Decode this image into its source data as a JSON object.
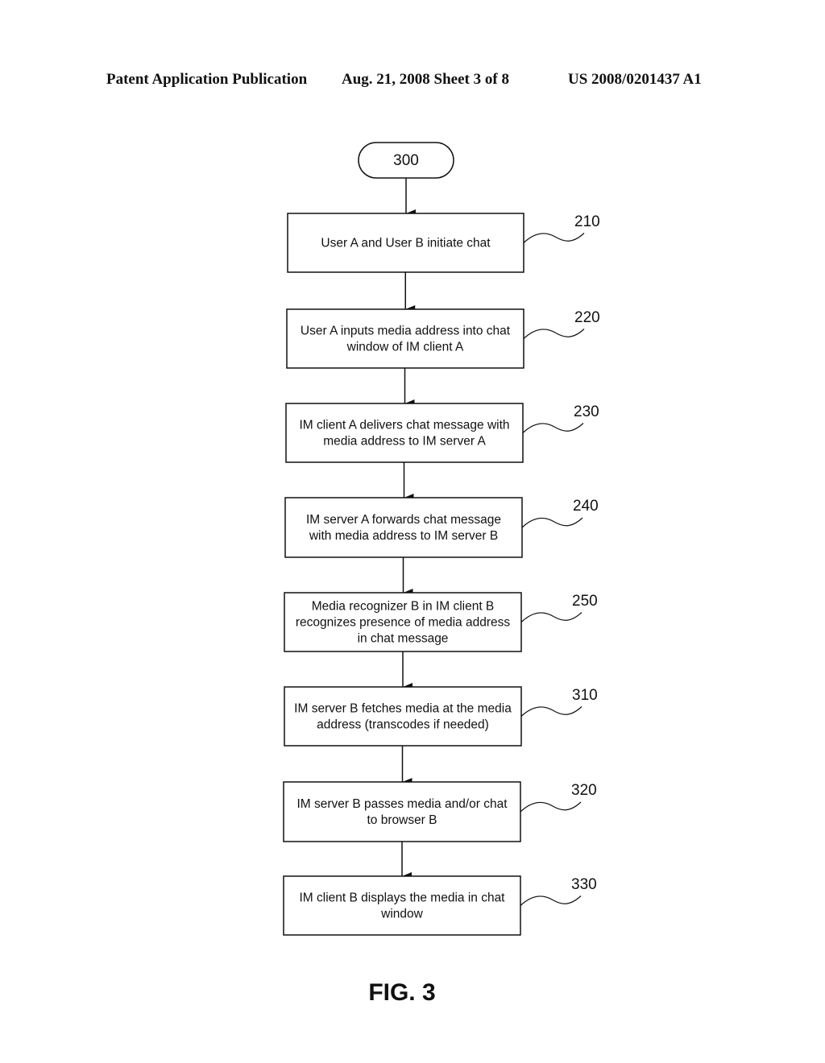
{
  "header": {
    "left": "Patent Application Publication",
    "middle": "Aug. 21, 2008  Sheet 3 of 8",
    "right": "US 2008/0201437 A1"
  },
  "diagram": {
    "start_label": "300",
    "steps": [
      {
        "ref": "210",
        "lines": [
          "User A and User B initiate chat"
        ]
      },
      {
        "ref": "220",
        "lines": [
          "User A inputs media address into chat",
          "window of IM client A"
        ]
      },
      {
        "ref": "230",
        "lines": [
          "IM client A delivers chat message with",
          "media address to IM server A"
        ]
      },
      {
        "ref": "240",
        "lines": [
          "IM server A forwards chat message",
          "with media address to IM server B"
        ]
      },
      {
        "ref": "250",
        "lines": [
          "Media recognizer B in IM client B",
          "recognizes presence of media address",
          "in chat message"
        ]
      },
      {
        "ref": "310",
        "lines": [
          "IM server B fetches media at the media",
          "address (transcodes if needed)"
        ]
      },
      {
        "ref": "320",
        "lines": [
          "IM server B passes media and/or chat",
          "to browser B"
        ]
      },
      {
        "ref": "330",
        "lines": [
          "IM client B displays the media in chat",
          "window"
        ]
      }
    ],
    "figure_label": "FIG. 3"
  }
}
